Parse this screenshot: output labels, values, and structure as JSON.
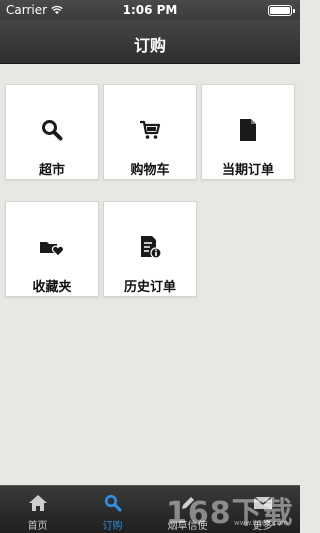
{
  "status_bar": {
    "carrier": "Carrier",
    "time": "1:06 PM",
    "battery_level": 1.0
  },
  "nav": {
    "title": "订购"
  },
  "tiles": [
    {
      "label": "超市",
      "icon": "search-icon"
    },
    {
      "label": "购物车",
      "icon": "cart-icon"
    },
    {
      "label": "当期订单",
      "icon": "document-icon"
    },
    {
      "label": "收藏夹",
      "icon": "favorites-icon"
    },
    {
      "label": "历史订单",
      "icon": "history-order-icon"
    }
  ],
  "tab_bar": {
    "tabs": [
      {
        "label": "首页",
        "icon": "home-icon",
        "active": false
      },
      {
        "label": "订购",
        "icon": "search-icon",
        "active": true
      },
      {
        "label": "烟草信使",
        "icon": "pen-icon",
        "active": false
      },
      {
        "label": "更多",
        "icon": "mail-icon",
        "active": false
      }
    ],
    "active_color": "#2f8fe0"
  },
  "watermark": {
    "text": "168下载",
    "url": "www.it168.com"
  }
}
